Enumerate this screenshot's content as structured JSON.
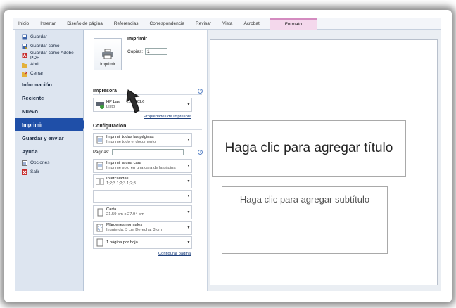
{
  "ribbon": {
    "tabs": [
      "Inicio",
      "Insertar",
      "Diseño de página",
      "Referencias",
      "Correspondencia",
      "Revisar",
      "Vista",
      "Acrobat"
    ],
    "context_tab": "Formato"
  },
  "nav": {
    "small_top": [
      {
        "label": "Guardar",
        "icon": "save-icon"
      },
      {
        "label": "Guardar como",
        "icon": "save-as-icon"
      },
      {
        "label": "Guardar como Adobe PDF",
        "icon": "pdf-icon"
      },
      {
        "label": "Abrir",
        "icon": "open-folder-icon"
      },
      {
        "label": "Cerrar",
        "icon": "close-folder-icon"
      }
    ],
    "big": [
      "Información",
      "Reciente",
      "Nuevo",
      "Imprimir",
      "Guardar y enviar",
      "Ayuda"
    ],
    "active": "Imprimir",
    "small_bottom": [
      {
        "label": "Opciones",
        "icon": "options-icon"
      },
      {
        "label": "Salir",
        "icon": "exit-icon"
      }
    ]
  },
  "print": {
    "heading": "Imprimir",
    "button_label": "Imprimir",
    "copies_label": "Copias:",
    "copies_value": "1"
  },
  "printer": {
    "section": "Impresora",
    "name": "HP LaserJet P1505 PCL6",
    "name_visible": "HP Las",
    "name_tail": "250 PCL6",
    "status": "Listo",
    "properties_link": "Propiedades de impresora"
  },
  "config": {
    "section": "Configuración",
    "pages_label": "Páginas:",
    "pages_value": "",
    "settings": [
      {
        "main": "Imprimir todas las páginas",
        "sub": "Imprime todo el documento",
        "icon": "pages-icon"
      },
      {
        "main": "Imprimir a una cara",
        "sub": "Imprime solo en una cara de la página",
        "icon": "one-side-icon"
      },
      {
        "main": "Intercaladas",
        "sub": "1;2;3    1;2;3    1;2;3",
        "icon": "collate-icon"
      },
      {
        "main": "",
        "sub": "",
        "icon": ""
      },
      {
        "main": "Carta",
        "sub": "21.59 cm x 27.94 cm",
        "icon": "paper-icon"
      },
      {
        "main": "Márgenes normales",
        "sub": "Izquierda:  3 cm     Derecha:  3 cm",
        "icon": "margins-icon"
      },
      {
        "main": "1 página por hoja",
        "sub": "",
        "icon": "page-per-sheet-icon"
      }
    ],
    "page_setup_link": "Configurar página"
  },
  "preview": {
    "title_placeholder": "Haga clic para agregar título",
    "subtitle_placeholder": "Haga clic para agregar subtítulo"
  },
  "colors": {
    "nav_bg": "#dde5f0",
    "active": "#1f4fa8",
    "context_tab": "#f4d8ec"
  }
}
